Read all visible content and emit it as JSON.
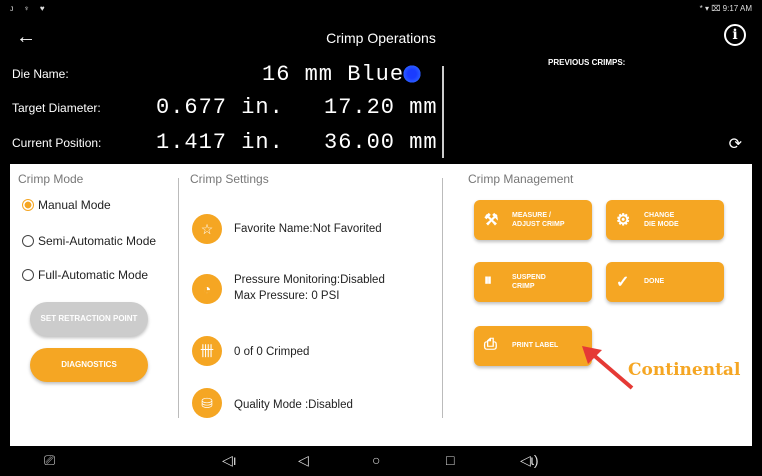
{
  "status": {
    "left_icons": "ᴊ ♆ ♥",
    "right": "* ▾ ⌧ 9:17 AM"
  },
  "appbar": {
    "title": "Crimp Operations",
    "back_icon": "←",
    "info_icon": "i"
  },
  "header": {
    "die_label": "Die Name:",
    "die_value": "16 mm Blue",
    "target_label": "Target Diameter:",
    "target_in": "0.677 in.",
    "target_mm": "17.20 mm",
    "current_label": "Current Position:",
    "current_in": "1.417 in.",
    "current_mm": "36.00 mm",
    "previous_label": "PREVIOUS CRIMPS:",
    "die_color": "#1a3cff"
  },
  "crimp_mode": {
    "title": "Crimp Mode",
    "options": [
      "Manual Mode",
      "Semi-Automatic Mode",
      "Full-Automatic Mode"
    ],
    "selected": "Manual Mode",
    "set_retraction_label": "SET RETRACTION POINT",
    "diagnostics_label": "DIAGNOSTICS"
  },
  "crimp_settings": {
    "title": "Crimp Settings",
    "favorite": "Favorite Name:Not Favorited",
    "pressure": "Pressure Monitoring:Disabled",
    "max_pressure": "Max Pressure: 0 PSI",
    "crimped": "0 of 0 Crimped",
    "quality": "Quality Mode :Disabled"
  },
  "crimp_management": {
    "title": "Crimp Management",
    "measure_label": [
      "MEASURE /",
      "ADJUST CRIMP"
    ],
    "change_label": [
      "CHANGE",
      "DIE MODE"
    ],
    "suspend_label": [
      "SUSPEND",
      "CRIMP"
    ],
    "done_label": "DONE",
    "print_label": "PRINT LABEL",
    "brand": "Continental"
  },
  "colors": {
    "accent": "#f5a623",
    "disabled": "#cccccc",
    "arrow": "#e53935"
  }
}
